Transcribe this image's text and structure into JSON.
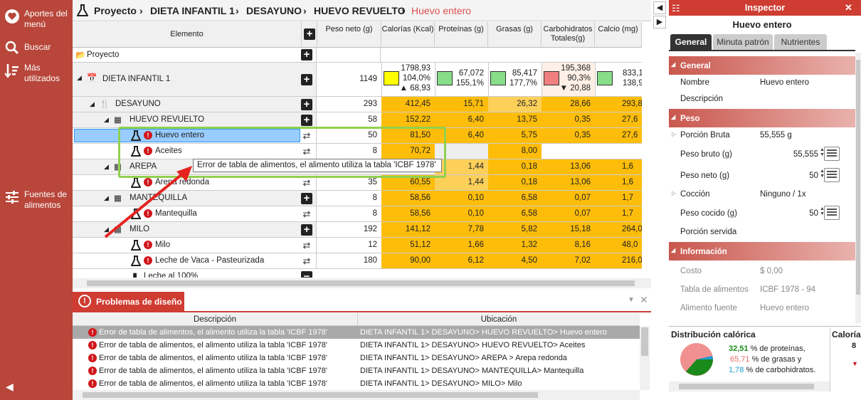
{
  "sidebar": {
    "items": [
      {
        "label": "Aportes del menú",
        "icon": "heart-icon"
      },
      {
        "label": "Buscar",
        "icon": "search-icon"
      },
      {
        "label": "Más utilizados",
        "icon": "sort-icon"
      },
      {
        "label": "Fuentes de alimentos",
        "icon": "sliders-icon"
      }
    ],
    "collapse_icon": "chevron-left-icon"
  },
  "breadcrumb": [
    "Proyecto",
    "DIETA INFANTIL 1",
    "DESAYUNO",
    "HUEVO REVUELTO",
    "Huevo entero"
  ],
  "grid": {
    "headers": {
      "elemento": "Elemento",
      "peso": "Peso neto (g)",
      "calorias": "Calorías (Kcal)",
      "proteinas": "Proteínas (g)",
      "grasas": "Grasas (g)",
      "carbohidratos": "Carbohidratos Totales(g)",
      "calcio": "Calcio (mg)"
    },
    "rows": [
      {
        "name": "Proyecto",
        "peso": "",
        "cal": "",
        "pro": "",
        "gra": "",
        "car": "",
        "calc": ""
      },
      {
        "name": "DIETA INFANTIL 1",
        "peso": "1149",
        "cal": "1798,93",
        "cal_pct": "104,0%",
        "cal_diff": "▲ 68,93",
        "pro": "67,072",
        "pro_pct": "155,1%",
        "gra": "85,417",
        "gra_pct": "177,7%",
        "car": "195,368",
        "car_pct": "90,3%",
        "car_diff": "▼ 20,88",
        "calc": "833,1",
        "calc_pct": "138,9"
      },
      {
        "name": "DESAYUNO",
        "peso": "293",
        "cal": "412,45",
        "pro": "15,71",
        "gra": "26,32",
        "car": "28,66",
        "calc": "293,8"
      },
      {
        "name": "HUEVO REVUELTO",
        "peso": "58",
        "cal": "152,22",
        "pro": "6,40",
        "gra": "13,75",
        "car": "0,35",
        "calc": "27,6"
      },
      {
        "name": "Huevo entero",
        "peso": "50",
        "cal": "81,50",
        "pro": "6,40",
        "gra": "5,75",
        "car": "0,35",
        "calc": "27,6"
      },
      {
        "name": "Aceites",
        "peso": "8",
        "cal": "70,72",
        "pro": "",
        "gra": "8,00",
        "car": "",
        "calc": ""
      },
      {
        "name": "AREPA",
        "peso": "",
        "cal": "",
        "pro": "1,44",
        "gra": "0,18",
        "car": "13,06",
        "calc": "1,6"
      },
      {
        "name": "Arepa redonda",
        "peso": "35",
        "cal": "60,55",
        "pro": "1,44",
        "gra": "0,18",
        "car": "13,06",
        "calc": "1,6"
      },
      {
        "name": "MANTEQUILLA",
        "peso": "8",
        "cal": "58,56",
        "pro": "0,10",
        "gra": "6,58",
        "car": "0,07",
        "calc": "1,7"
      },
      {
        "name": "Mantequilla",
        "peso": "8",
        "cal": "58,56",
        "pro": "0,10",
        "gra": "6,58",
        "car": "0,07",
        "calc": "1,7"
      },
      {
        "name": "MILO",
        "peso": "192",
        "cal": "141,12",
        "pro": "7,78",
        "gra": "5,82",
        "car": "15,18",
        "calc": "264,0"
      },
      {
        "name": "Milo",
        "peso": "12",
        "cal": "51,12",
        "pro": "1,66",
        "gra": "1,32",
        "car": "8,16",
        "calc": "48,0"
      },
      {
        "name": "Leche de Vaca - Pasteurizada",
        "peso": "180",
        "cal": "90,00",
        "pro": "6,12",
        "gra": "4,50",
        "car": "7,02",
        "calc": "216,0"
      },
      {
        "name": "Leche al 100%",
        "peso": "",
        "cal": "",
        "pro": "",
        "gra": "",
        "car": "",
        "calc": ""
      }
    ],
    "tooltip": "Error de tabla de alimentos, el alimento utiliza la tabla 'ICBF 1978'"
  },
  "problems": {
    "title": "Problemas de diseño",
    "col_desc": "Descripción",
    "col_loc": "Ubicación",
    "rows": [
      {
        "desc": "Error de tabla de alimentos, el alimento utiliza la tabla 'ICBF 1978'",
        "loc": "DIETA INFANTIL 1> DESAYUNO> HUEVO REVUELTO> Huevo entero"
      },
      {
        "desc": "Error de tabla de alimentos, el alimento utiliza la tabla 'ICBF 1978'",
        "loc": "DIETA INFANTIL 1> DESAYUNO> HUEVO REVUELTO> Aceites"
      },
      {
        "desc": "Error de tabla de alimentos, el alimento utiliza la tabla 'ICBF 1978'",
        "loc": "DIETA INFANTIL 1> DESAYUNO> AREPA > Arepa redonda"
      },
      {
        "desc": "Error de tabla de alimentos, el alimento utiliza la tabla 'ICBF 1978'",
        "loc": "DIETA INFANTIL 1> DESAYUNO> MANTEQUILLA> Mantequilla"
      },
      {
        "desc": "Error de tabla de alimentos, el alimento utiliza la tabla 'ICBF 1978'",
        "loc": "DIETA INFANTIL 1> DESAYUNO> MILO> Milo"
      }
    ]
  },
  "inspector": {
    "title": "Inspector",
    "subtitle": "Huevo entero",
    "tabs": [
      "General",
      "Minuta patrón",
      "Nutrientes"
    ],
    "sections": {
      "general": "General",
      "peso": "Peso",
      "informacion": "Información"
    },
    "props": {
      "nombre_label": "Nombre",
      "nombre_value": "Huevo entero",
      "descripcion_label": "Descripción",
      "porcion_bruta_label": "Porción Bruta",
      "porcion_bruta_value": "55,555 g",
      "peso_bruto_label": "Peso bruto (g)",
      "peso_bruto_value": "55,555",
      "peso_neto_label": "Peso neto (g)",
      "peso_neto_value": "50",
      "coccion_label": "Cocción",
      "coccion_value": "Ninguno / 1x",
      "peso_cocido_label": "Peso cocido (g)",
      "peso_cocido_value": "50",
      "porcion_servida_label": "Porción servida",
      "costo_label": "Costo",
      "costo_value": "$ 0,00",
      "tabla_label": "Tabla de alimentos",
      "tabla_value": "ICBF 1978 - 94",
      "fuente_label": "Alimento fuente",
      "fuente_value": "Huevo entero"
    },
    "distribucion": {
      "title": "Distribución calórica",
      "proteinas_pct": "32,51",
      "proteinas_text": "% de proteínas,",
      "grasas_pct": "65,71",
      "grasas_text": "% de grasas y",
      "carbo_pct": "1,78",
      "carbo_text": "% de carbohidratos.",
      "calorias_label": "Caloría",
      "calorias_value": "8"
    },
    "colors": {
      "proteinas": "#1a8a1a",
      "grasas": "#e86a6a",
      "carbohidratos": "#1a9ad6"
    }
  }
}
